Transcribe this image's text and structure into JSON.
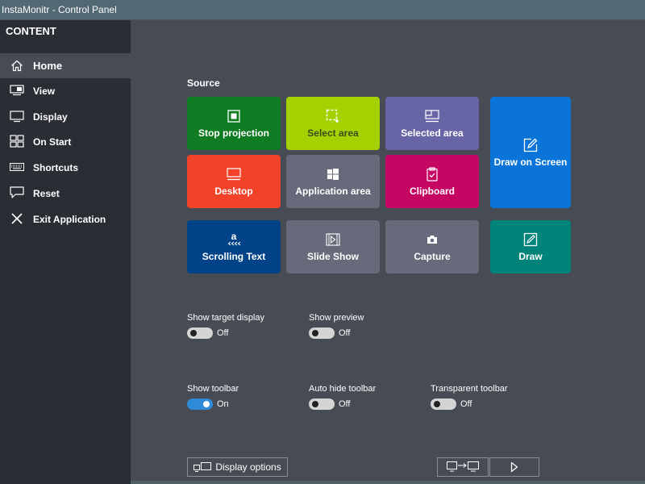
{
  "window": {
    "title": "InstaMonitr - Control Panel"
  },
  "sidebar": {
    "header": "CONTENT",
    "items": [
      {
        "label": "Home",
        "icon": "home-icon",
        "active": true
      },
      {
        "label": "View",
        "icon": "view-icon",
        "active": false
      },
      {
        "label": "Display",
        "icon": "monitor-icon",
        "active": false
      },
      {
        "label": "On Start",
        "icon": "grid-icon",
        "active": false
      },
      {
        "label": "Shortcuts",
        "icon": "keyboard-icon",
        "active": false
      },
      {
        "label": "Reset",
        "icon": "speech-bubble-icon",
        "active": false
      },
      {
        "label": "Exit Application",
        "icon": "close-icon",
        "active": false
      }
    ]
  },
  "source": {
    "title": "Source",
    "tiles": [
      {
        "label": "Stop projection",
        "icon": "stop-icon",
        "color": "#0f7b22"
      },
      {
        "label": "Select area",
        "icon": "select-area-icon",
        "color": "#a5d100"
      },
      {
        "label": "Selected area",
        "icon": "selected-area-icon",
        "color": "#6765a5"
      },
      {
        "label": "Draw on Screen",
        "icon": "pen-square-icon",
        "color": "#0a74d9"
      },
      {
        "label": "Desktop",
        "icon": "desktop-icon",
        "color": "#f3422a"
      },
      {
        "label": "Application area",
        "icon": "windows-icon",
        "color": "#666a7a"
      },
      {
        "label": "Clipboard",
        "icon": "clipboard-icon",
        "color": "#c60663"
      },
      {
        "label": "Scrolling Text",
        "icon": "scrolling-text-icon",
        "color": "#004388"
      },
      {
        "label": "Slide Show",
        "icon": "slideshow-icon",
        "color": "#666a7a"
      },
      {
        "label": "Capture",
        "icon": "camera-icon",
        "color": "#666a7a"
      },
      {
        "label": "Draw",
        "icon": "draw-icon",
        "color": "#00847a"
      }
    ]
  },
  "toggles": [
    {
      "label": "Show target display",
      "state": "Off",
      "on": false
    },
    {
      "label": "Show preview",
      "state": "Off",
      "on": false
    },
    {
      "label": "Show toolbar",
      "state": "On",
      "on": true
    },
    {
      "label": "Auto hide toolbar",
      "state": "Off",
      "on": false
    },
    {
      "label": "Transparent toolbar",
      "state": "Off",
      "on": false
    }
  ],
  "footer": {
    "display_options_label": "Display options"
  }
}
